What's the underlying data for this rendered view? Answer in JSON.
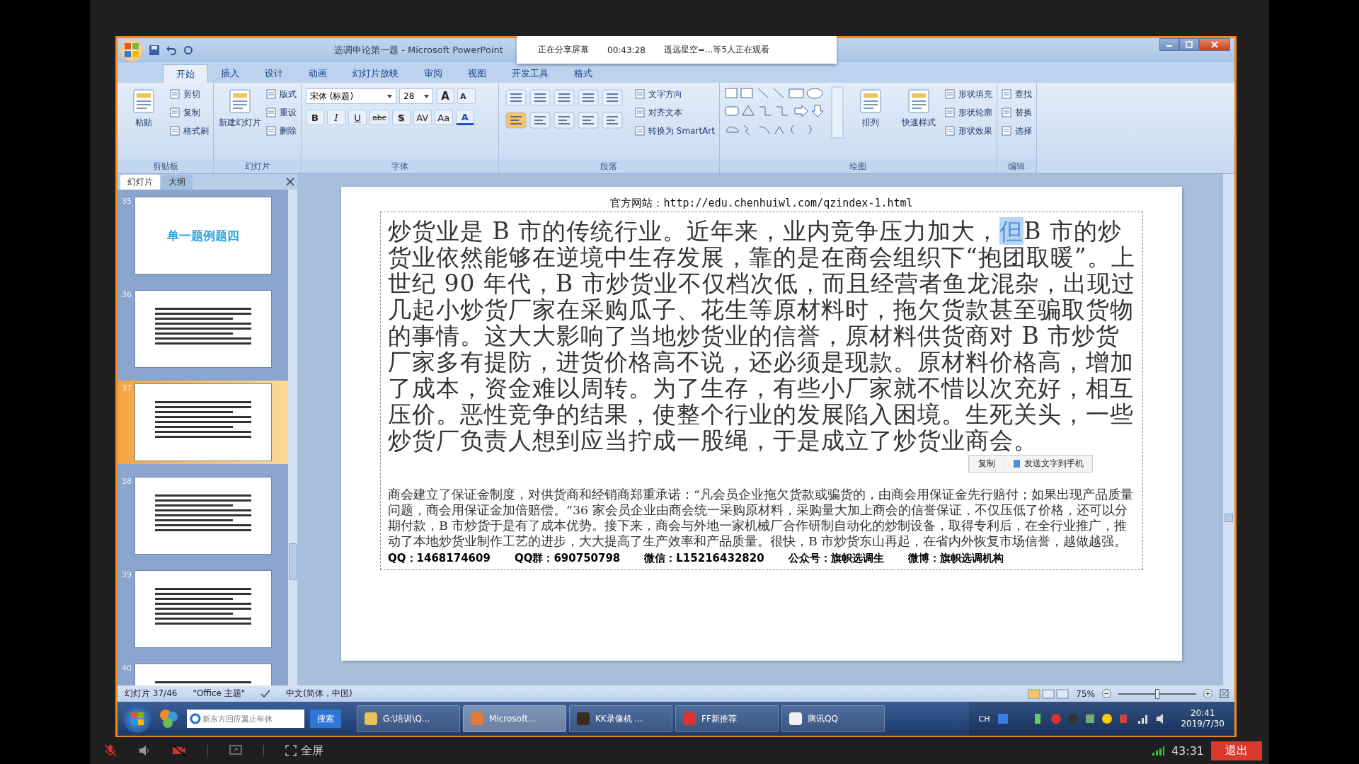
{
  "window": {
    "title": "选调申论第一题 - Microsoft PowerPoint"
  },
  "share_banner": {
    "status": "正在分享屏幕",
    "elapsed": "00:43:28",
    "viewers": "遥远星空=...等5人正在观看"
  },
  "ribbon": {
    "tabs": [
      {
        "label": "开始",
        "selected": true
      },
      {
        "label": "插入",
        "selected": false
      },
      {
        "label": "设计",
        "selected": false
      },
      {
        "label": "动画",
        "selected": false
      },
      {
        "label": "幻灯片放映",
        "selected": false
      },
      {
        "label": "审阅",
        "selected": false
      },
      {
        "label": "视图",
        "selected": false
      },
      {
        "label": "开发工具",
        "selected": false
      },
      {
        "label": "格式",
        "selected": false
      }
    ],
    "groups": [
      {
        "label": "剪贴板",
        "kind": "plain",
        "items": [
          {
            "label": "粘贴",
            "kind": "large"
          },
          {
            "label": "剪切",
            "kind": "small"
          },
          {
            "label": "复制",
            "kind": "small"
          },
          {
            "label": "格式刷",
            "kind": "small"
          }
        ]
      },
      {
        "label": "幻灯片",
        "kind": "plain",
        "items": [
          {
            "label": "新建幻灯片",
            "kind": "large"
          },
          {
            "label": "版式",
            "kind": "small"
          },
          {
            "label": "重设",
            "kind": "small"
          },
          {
            "label": "删除",
            "kind": "small"
          }
        ]
      },
      {
        "label": "字体",
        "kind": "plain",
        "items": [
          {
            "label": "宋体 (标题)",
            "kind": "field"
          },
          {
            "label": "28",
            "kind": "field"
          },
          {
            "label": "A",
            "kind": "glyph"
          },
          {
            "label": "A",
            "kind": "glyph"
          },
          {
            "label": "B",
            "kind": "glyph"
          },
          {
            "label": "I",
            "kind": "glyph"
          },
          {
            "label": "U",
            "kind": "glyph"
          },
          {
            "label": "abc",
            "kind": "glyph"
          },
          {
            "label": "S",
            "kind": "glyph"
          },
          {
            "label": "AV",
            "kind": "glyph"
          },
          {
            "label": "Aa",
            "kind": "glyph"
          },
          {
            "label": "A",
            "kind": "glyph"
          }
        ]
      },
      {
        "label": "段落",
        "kind": "paragraph",
        "items": [
          {
            "label": "文字方向",
            "kind": "small"
          },
          {
            "label": "对齐文本",
            "kind": "small"
          },
          {
            "label": "转换为 SmartArt",
            "kind": "small"
          }
        ]
      },
      {
        "label": "绘图",
        "kind": "drawing",
        "items": [
          {
            "label": "排列",
            "kind": "large"
          },
          {
            "label": "快速样式",
            "kind": "large"
          },
          {
            "label": "形状填充",
            "kind": "small"
          },
          {
            "label": "形状轮廓",
            "kind": "small"
          },
          {
            "label": "形状效果",
            "kind": "small"
          }
        ]
      },
      {
        "label": "编辑",
        "kind": "plain",
        "items": [
          {
            "label": "查找",
            "kind": "small"
          },
          {
            "label": "替换",
            "kind": "small"
          },
          {
            "label": "选择",
            "kind": "small"
          }
        ]
      }
    ]
  },
  "slides_pane": {
    "tabs": [
      {
        "label": "幻灯片",
        "selected": true
      },
      {
        "label": "大纲",
        "selected": false
      }
    ],
    "thumbnails": [
      {
        "number": "35",
        "selected": false,
        "title": "单一题例题四"
      },
      {
        "number": "36",
        "selected": false
      },
      {
        "number": "37",
        "selected": true
      },
      {
        "number": "38",
        "selected": false
      },
      {
        "number": "39",
        "selected": false
      },
      {
        "number": "40",
        "selected": false
      }
    ]
  },
  "slide": {
    "header": "官方网站：http://edu.chenhuiwl.com/qzindex-1.html",
    "paragraph": [
      {
        "text": "炒货业是 B 市的传统行业。近年来，业内竞争压力加大，",
        "selected": false
      },
      {
        "text": "但",
        "selected": true
      },
      {
        "text": "B 市的炒货业依然能够在逆境中生存发展，靠的是在商会组织下“抱团取暖”。上世纪 90 年代，B 市炒货业不仅档次低，而且经营者鱼龙混杂，出现过几起小炒货厂家在采购瓜子、花生等原材料时，拖欠货款甚至骗取货物的事情。这大大影响了当地炒货业的信誉，原材料供货商对 B 市炒货厂家多有提防，进货价格高不说，还必须是现款。原材料价格高，增加了成本，资金难以周转。为了生存，有些小厂家就不惜以次充好，相互压价。恶性竞争的结果，使整个行业的发展陷入困境。生死关头，一些炒货厂负责人想到应当拧成一股绳，于是成立了炒货业商会。",
        "selected": false
      }
    ],
    "body": "商会建立了保证金制度，对供货商和经销商郑重承诺：“凡会员企业拖欠货款或骗货的，由商会用保证金先行赔付；如果出现产品质量问题，商会用保证金加倍赔偿。”36 家会员企业由商会统一采购原材料，采购量大加上商会的信誉保证，不仅压低了价格，还可以分期付款，B 市炒货于是有了成本优势。接下来，商会与外地一家机械厂合作研制自动化的炒制设备，取得专利后，在全行业推广，推动了本地炒货业制作工艺的进步，大大提高了生产效率和产品质量。很快，B 市炒货东山再起，在省内外恢复市场信誉，越做越强。",
    "contact": [
      "QQ：1468174609",
      "QQ群：690750798",
      "微信：L15216432820",
      "公众号：旗帜选调生",
      "微博：旗帜选调机构"
    ],
    "context_menu": [
      "复制",
      "发送文字到手机"
    ]
  },
  "status_bar": {
    "slide": "幻灯片 37/46",
    "theme": "\"Office 主题\"",
    "language": "中文(简体，中国)",
    "zoom": "75%",
    "level": 0.5
  },
  "taskbar": {
    "search": "新东方回应翼止年休",
    "search_button": "搜索",
    "tasks": [
      {
        "label": "G:\\培训\\Q...",
        "selected": false
      },
      {
        "label": "Microsoft...",
        "selected": true
      },
      {
        "label": "KK录像机 ...",
        "selected": false
      },
      {
        "label": "FF新推荐",
        "selected": false
      },
      {
        "label": "腾讯QQ",
        "selected": false
      }
    ],
    "language": "CH",
    "time": "20:41",
    "date": "2019/7/30"
  },
  "player_bar": {
    "fullscreen": "全屏",
    "time": "43:31",
    "exit": "退出"
  }
}
